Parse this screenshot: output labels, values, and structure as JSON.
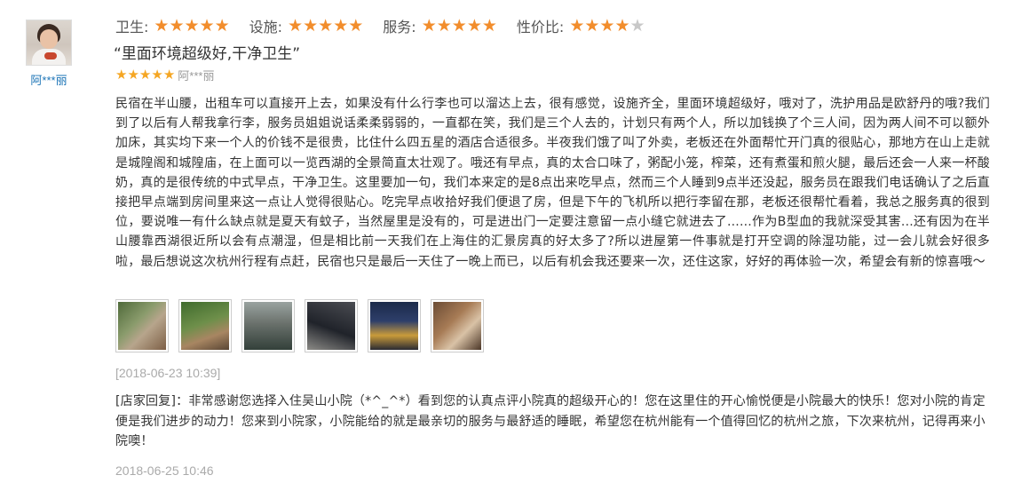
{
  "user": {
    "name": "阿***丽"
  },
  "ratings": [
    {
      "label": "卫生:",
      "stars": 5
    },
    {
      "label": "设施:",
      "stars": 5
    },
    {
      "label": "服务:",
      "stars": 5
    },
    {
      "label": "性价比:",
      "stars": 4
    }
  ],
  "review": {
    "title": "“里面环境超级好,干净卫生”",
    "overall_stars": 5,
    "author": "阿***丽",
    "body": "民宿在半山腰，出租车可以直接开上去，如果没有什么行李也可以溜达上去，很有感觉，设施齐全，里面环境超级好，哦对了，洗护用品是欧舒丹的哦?我们到了以后有人帮我拿行李，服务员姐姐说话柔柔弱弱的，一直都在笑，我们是三个人去的，计划只有两个人，所以加钱换了个三人间，因为两人间不可以额外加床，其实均下来一个人的价钱不是很贵，比住什么四五星的酒店合适很多。半夜我们饿了叫了外卖，老板还在外面帮忙开门真的很贴心，那地方在山上走就是城隍阁和城隍庙，在上面可以一览西湖的全景简直太壮观了。哦还有早点，真的太合口味了，粥配小笼，榨菜，还有煮蛋和煎火腿，最后还会一人来一杯酸奶，真的是很传统的中式早点，干净卫生。这里要加一句，我们本来定的是8点出来吃早点，然而三个人睡到9点半还没起，服务员在跟我们电话确认了之后直接把早点端到房间里来这一点让人觉得很贴心。吃完早点收拾好我们便退了房，但是下午的飞机所以把行李留在那，老板还很帮忙看着，我总之服务真的很到位，要说唯一有什么缺点就是夏天有蚊子，当然屋里是没有的，可是进出门一定要注意留一点小缝它就进去了......作为B型血的我就深受其害...还有因为在半山腰靠西湖很近所以会有点潮湿，但是相比前一天我们在上海住的汇景房真的好太多了?所以进屋第一件事就是打开空调的除湿功能，过一会儿就会好很多啦，最后想说这次杭州行程有点赶，民宿也只是最后一天住了一晚上而已，以后有机会我还要来一次，还住这家，好好的再体验一次，希望会有新的惊喜哦～",
    "date": "[2018-06-23 10:39]"
  },
  "photos": [
    "photo-1",
    "photo-2",
    "photo-3",
    "photo-4",
    "photo-5",
    "photo-6"
  ],
  "reply": {
    "text": "[店家回复]：非常感谢您选择入住吴山小院（*^_^*）看到您的认真点评小院真的超级开心的！您在这里住的开心愉悦便是小院最大的快乐！您对小院的肯定便是我们进步的动力！您来到小院家，小院能给的就是最亲切的服务与最舒适的睡眠，希望您在杭州能有一个值得回忆的杭州之旅，下次来杭州，记得再来小院噢！",
    "date": "2018-06-25 10:46"
  },
  "colors": {
    "star_on": "#f28d2c",
    "star_off": "#c8c8c8",
    "link": "#1a73b6",
    "muted": "#aaaaaa"
  }
}
